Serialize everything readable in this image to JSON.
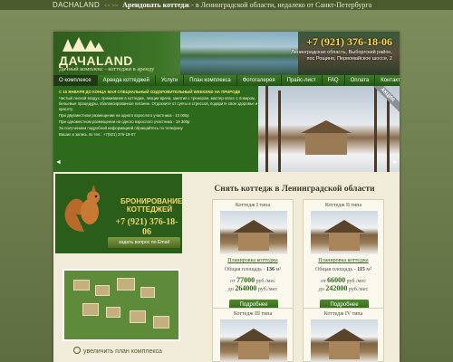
{
  "topbar": {
    "brand": "DACHALAND",
    "arrows": "<< >>",
    "tagline": "Арендовать коттедж",
    "tagline_rest": " - в Ленинградской области, недалеко от Санкт-Петербурга"
  },
  "header": {
    "logo": "ДАЧАLAND",
    "slogan": "Дачный комплекс - коттеджи в аренду",
    "phone": "+7 (921) 376-18-06",
    "address": "Ленинградская область, Выборгский район, пос Рощино, Первомайское шоссе, 2"
  },
  "nav": {
    "items": [
      "О комплексе",
      "Аренда коттеджей",
      "Услуги",
      "План комплекса",
      "Фотогалерея",
      "Прайс-лист",
      "FAQ",
      "Оплата",
      "Контакты"
    ]
  },
  "promo": {
    "lines": [
      "С 15 ЯНВАРЯ ДО КОНЦА МАЯ СПЕЦИАЛЬНЫЙ ОЗДОРОВИТЕЛЬНЫЙ WEEKEND НА ПРИРОДЕ",
      "Чистый лесной воздух, проживание в коттедже, лекции врача, занятия с тренером, мастер класс 1 поваром, бельевые процедуры, сбалансированное питание. Отдохните от суеты и стрессов, подарите свое здоровье и красоту",
      "При двухместном размещении на одного взрослого участника - 13 000р",
      "При одноместном размещении на одного взрослого участника - 19 300р",
      "За получением подробной информацией обращайтесь по телефону",
      "Ваших и запись по тел.: +7(921) 376-18-07"
    ],
    "ribbon": "АКЦИЯ",
    "prev": "◄",
    "next": "►"
  },
  "booking": {
    "label": "БРОНИРОВАНИЕ КОТТЕДЖЕЙ",
    "phone": "+7 (921) 376-18-06",
    "ask_button": "задать вопрос по Email"
  },
  "map": {
    "zoom_link": "увеличить план комплекса"
  },
  "main": {
    "title": "Снять коттедж в Ленинградской области",
    "cards": [
      {
        "title": "Коттедж I типа",
        "plan_link": "Планировка коттеджа",
        "area_label": "Общая площадь -",
        "area_value": "136",
        "area_unit": "м²",
        "price_from_label": "от",
        "price_from": "77000",
        "price_from_unit": "руб./мес",
        "price_to_label": "до",
        "price_to": "264000",
        "price_to_unit": "руб./мес",
        "more_button": "Подробнее"
      },
      {
        "title": "Коттедж II типа",
        "plan_link": "Планировка коттеджа",
        "area_label": "Общая площадь -",
        "area_value": "115",
        "area_unit": "м²",
        "price_from_label": "от",
        "price_from": "66000",
        "price_from_unit": "руб./мес",
        "price_to_label": "до",
        "price_to": "242000",
        "price_to_unit": "руб./мес",
        "more_button": "Подробнее"
      },
      {
        "title": "Коттедж III типа"
      },
      {
        "title": "Коттедж IV типа"
      }
    ]
  },
  "colors": {
    "page_bg": "#6d7d4e",
    "nav_green": "#2f6a1c",
    "accent_yellow": "#ffd84a",
    "price_green": "#2b6a1a"
  }
}
